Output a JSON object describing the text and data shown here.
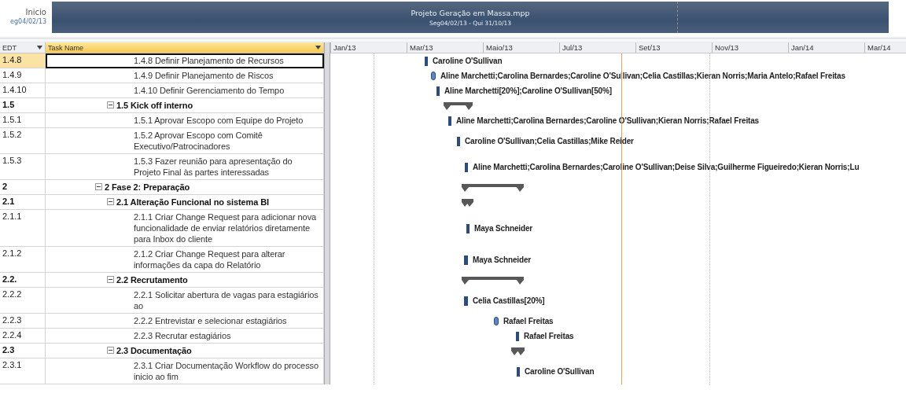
{
  "timeline": {
    "start_label": "Inicio",
    "start_date": "eg04/02/13",
    "title": "Projeto Geração em Massa.mpp",
    "dates": "Seg04/02/13 - Qui 31/10/13"
  },
  "columns": [
    {
      "label": "EDT",
      "selected": false
    },
    {
      "label": "Task Name",
      "selected": true
    }
  ],
  "months": [
    "Jan/13",
    "Mar/13",
    "Maio/13",
    "Jul/13",
    "Set/13",
    "Nov/13",
    "Jan/14",
    "Mar/14"
  ],
  "tasks": [
    {
      "children": [
        {
          "children": [
            {
              "edt": "1.4.8",
              "name": "1.4.8 Definir Planejamento de Recursos",
              "selected": true,
              "bar": {
                "kind": "task",
                "resources": "Caroline O'Sullivan"
              }
            },
            {
              "edt": "1.4.9",
              "name": "1.4.9 Definir Planejamento de Riscos",
              "selected": false,
              "bar": {
                "kind": "capsule",
                "resources": "Aline Marchetti;Carolina Bernardes;Caroline O'Sullivan;Celia Castillas;Kieran Norris;Maria Antelo;Rafael Freitas"
              }
            },
            {
              "edt": "1.4.10",
              "name": "1.4.10 Definir Gerenciamento do Tempo",
              "selected": false,
              "bar": {
                "kind": "task",
                "resources": "Aline Marchetti[20%];Caroline O'Sullivan[50%]"
              }
            }
          ]
        },
        {
          "edt": "1.5",
          "name": "1.5 Kick off interno",
          "selected": false,
          "expanded": true,
          "bar": {
            "kind": "summary"
          },
          "children": [
            {
              "edt": "1.5.1",
              "name": "1.5.1 Aprovar Escopo com Equipe do Projeto",
              "selected": false,
              "bar": {
                "kind": "task",
                "resources": "Aline Marchetti;Carolina Bernardes;Caroline O'Sullivan;Kieran Norris;Rafael Freitas"
              }
            },
            {
              "edt": "1.5.2",
              "name": "1.5.2 Aprovar Escopo com Comitê Executivo/Patrocinadores",
              "selected": false,
              "bar": {
                "kind": "task",
                "resources": "Caroline O'Sullivan;Celia Castillas;Mike Reider"
              }
            },
            {
              "edt": "1.5.3",
              "name": "1.5.3 Fazer reunião para apresentação do Projeto Final às partes interessadas",
              "selected": false,
              "bar": {
                "kind": "task",
                "resources": "Aline Marchetti;Carolina Bernardes;Caroline O'Sullivan;Deise Silva;Guilherme Figueiredo;Kieran Norris;Lu"
              }
            }
          ]
        }
      ]
    },
    {
      "edt": "2",
      "name": "2 Fase 2: Preparação",
      "selected": false,
      "expanded": true,
      "bar": {
        "kind": "summary"
      },
      "children": [
        {
          "edt": "2.1",
          "name": "2.1 Alteração Funcional no sistema BI",
          "selected": false,
          "expanded": true,
          "bar": {
            "kind": "summary"
          },
          "children": [
            {
              "edt": "2.1.1",
              "name": "2.1.1 Criar Change Request para adicionar nova funcionalidade de enviar relatórios diretamente para Inbox do cliente",
              "selected": false,
              "bar": {
                "kind": "task",
                "resources": "Maya Schneider"
              }
            },
            {
              "edt": "2.1.2",
              "name": "2.1.2 Criar Change Request para alterar informações da capa do Relatório",
              "selected": false,
              "bar": {
                "kind": "task",
                "resources": "Maya Schneider"
              }
            }
          ]
        },
        {
          "edt": "2.2.",
          "name": "2.2 Recrutamento",
          "selected": false,
          "expanded": true,
          "bar": {
            "kind": "summary"
          },
          "children": [
            {
              "edt": "2.2.2",
              "name": "2.2.1 Solicitar abertura de vagas para estagiários ao",
              "selected": false,
              "bar": {
                "kind": "task",
                "resources": "Celia Castillas[20%]"
              }
            },
            {
              "edt": "2.2.3",
              "name": "2.2.2 Entrevistar e selecionar estagiários",
              "selected": false,
              "bar": {
                "kind": "capsule",
                "resources": "Rafael Freitas"
              }
            },
            {
              "edt": "2.2.4",
              "name": "2.2.3 Recrutar estagiários",
              "selected": false,
              "bar": {
                "kind": "task",
                "resources": "Rafael Freitas"
              }
            }
          ]
        },
        {
          "edt": "2.3",
          "name": "2.3 Documentação",
          "selected": false,
          "expanded": true,
          "bar": {
            "kind": "summary"
          },
          "children": [
            {
              "edt": "2.3.1",
              "name": "2.3.1 Criar Documentação Workflow do processo inicio ao fim",
              "selected": false,
              "bar": {
                "kind": "task",
                "resources": "Caroline O'Sullivan"
              }
            }
          ]
        }
      ]
    }
  ]
}
